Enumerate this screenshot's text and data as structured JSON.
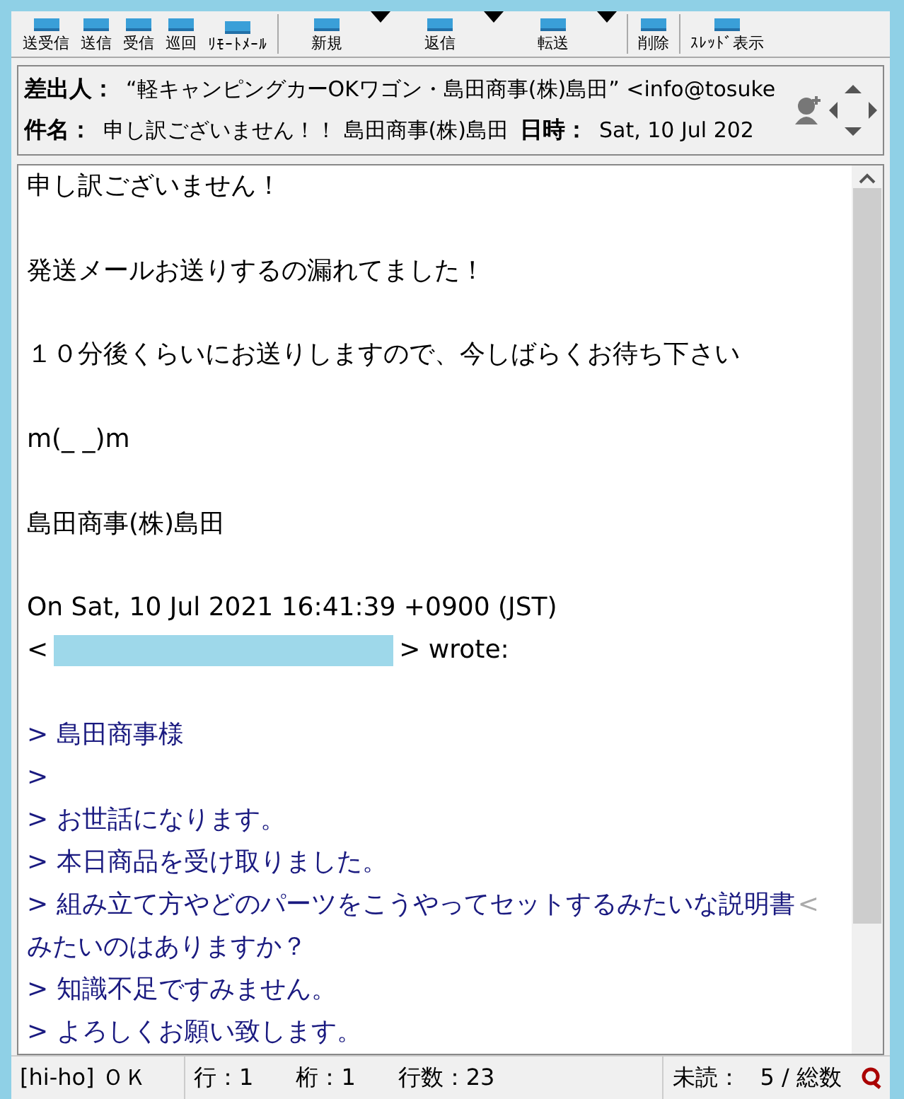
{
  "toolbar": [
    {
      "label": "送受信",
      "kind": "button"
    },
    {
      "label": "送信",
      "kind": "button"
    },
    {
      "label": "受信",
      "kind": "button"
    },
    {
      "label": "巡回",
      "kind": "button"
    },
    {
      "label": "ﾘﾓｰﾄﾒｰﾙ",
      "kind": "button"
    },
    {
      "label": "新規",
      "kind": "dropdown"
    },
    {
      "label": "返信",
      "kind": "dropdown"
    },
    {
      "label": "転送",
      "kind": "dropdown"
    },
    {
      "label": "削除",
      "kind": "button"
    },
    {
      "label": "ｽﾚｯﾄﾞ表示",
      "kind": "button"
    }
  ],
  "header": {
    "from_label": "差出人：",
    "from": "“軽キャンピングカーOKワゴン・島田商事(株)島田” <info@tosuke",
    "subject_label": "件名：",
    "subject": "申し訳ございません！！ 島田商事(株)島田",
    "date_label": "日時：",
    "date": "Sat, 10 Jul 202"
  },
  "body": [
    {
      "kind": "text",
      "text": "申し訳ございません！"
    },
    {
      "kind": "blank"
    },
    {
      "kind": "text",
      "text": "発送メールお送りするの漏れてました！"
    },
    {
      "kind": "blank"
    },
    {
      "kind": "text",
      "text": "１０分後くらいにお送りしますので、今しばらくお待ち下さい"
    },
    {
      "kind": "blank"
    },
    {
      "kind": "text",
      "text": "m(_ _)m"
    },
    {
      "kind": "blank"
    },
    {
      "kind": "text",
      "text": " 島田商事(株)島田"
    },
    {
      "kind": "blank"
    },
    {
      "kind": "text",
      "text": "On Sat, 10 Jul 2021 16:41:39 +0900 (JST)"
    },
    {
      "kind": "redacted",
      "before": "<",
      "after": "> wrote:"
    },
    {
      "kind": "blank"
    },
    {
      "kind": "quote",
      "text": "> 島田商事様"
    },
    {
      "kind": "quote",
      "text": ">"
    },
    {
      "kind": "quote",
      "text": "> お世話になります。"
    },
    {
      "kind": "quote",
      "text": "> 本日商品を受け取りました。"
    },
    {
      "kind": "quote",
      "text": "> 組み立て方やどのパーツをこうやってセットするみたいな説明書",
      "wrap_mark": "<"
    },
    {
      "kind": "quote",
      "text": "みたいのはありますか？"
    },
    {
      "kind": "quote",
      "text": "> 知識不足ですみません。"
    },
    {
      "kind": "quote",
      "text": "> よろしくお願い致します。"
    }
  ],
  "status": {
    "account": "[hi-ho] ＯＫ",
    "line": "行：1",
    "column": "桁：1",
    "line_count": "行数：23",
    "unread": "未読：",
    "total": "5 / 総数"
  }
}
